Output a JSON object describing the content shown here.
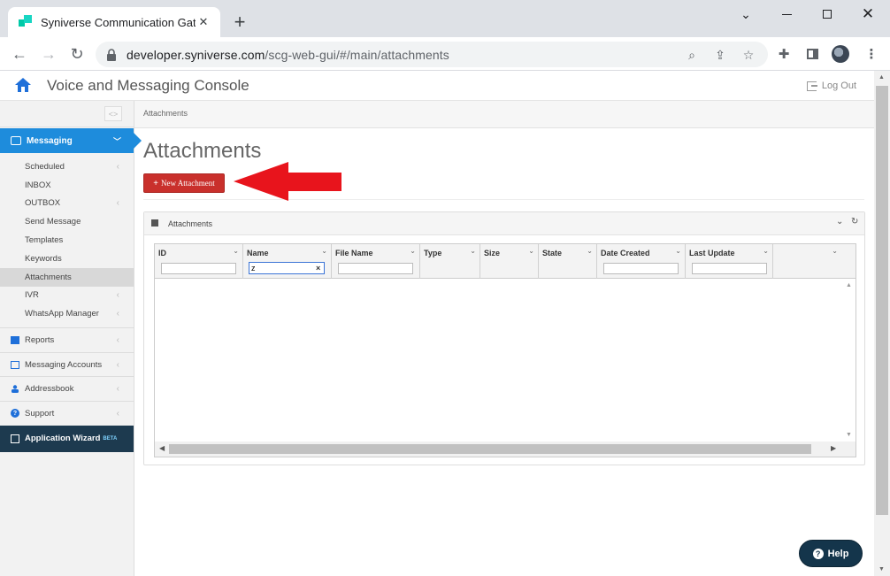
{
  "browser": {
    "tab_title": "Syniverse Communication Gatew",
    "url_domain": "developer.syniverse.com",
    "url_path": "/scg-web-gui/#/main/attachments"
  },
  "app": {
    "title": "Voice and Messaging Console",
    "logout_label": "Log Out"
  },
  "sidebar": {
    "messaging_label": "Messaging",
    "sub_items": [
      {
        "label": "Scheduled",
        "has_submenu": true
      },
      {
        "label": "INBOX",
        "has_submenu": false
      },
      {
        "label": "OUTBOX",
        "has_submenu": true
      },
      {
        "label": "Send Message",
        "has_submenu": false
      },
      {
        "label": "Templates",
        "has_submenu": false
      },
      {
        "label": "Keywords",
        "has_submenu": false
      },
      {
        "label": "Attachments",
        "has_submenu": false,
        "active": true
      },
      {
        "label": "IVR",
        "has_submenu": true
      },
      {
        "label": "WhatsApp Manager",
        "has_submenu": true
      }
    ],
    "main_items": [
      {
        "label": "Reports",
        "icon": "reports-icon"
      },
      {
        "label": "Messaging Accounts",
        "icon": "monitor-icon"
      },
      {
        "label": "Addressbook",
        "icon": "users-icon"
      },
      {
        "label": "Support",
        "icon": "question-icon"
      }
    ],
    "wizard_label": "Application Wizard",
    "wizard_badge": "BETA"
  },
  "main": {
    "breadcrumb": "Attachments",
    "page_title": "Attachments",
    "new_button_label": "New Attachment",
    "panel_title": "Attachments"
  },
  "grid": {
    "columns": [
      {
        "label": "ID",
        "filter_value": ""
      },
      {
        "label": "Name",
        "filter_value": "z"
      },
      {
        "label": "File Name",
        "filter_value": ""
      },
      {
        "label": "Type"
      },
      {
        "label": "Size"
      },
      {
        "label": "State"
      },
      {
        "label": "Date Created",
        "filter_value": ""
      },
      {
        "label": "Last Update",
        "filter_value": ""
      },
      {
        "label": ""
      }
    ]
  },
  "help_label": "Help",
  "colors": {
    "accent_blue": "#1e8cdc",
    "danger_red": "#c9302c",
    "dark_navy": "#14354b"
  }
}
